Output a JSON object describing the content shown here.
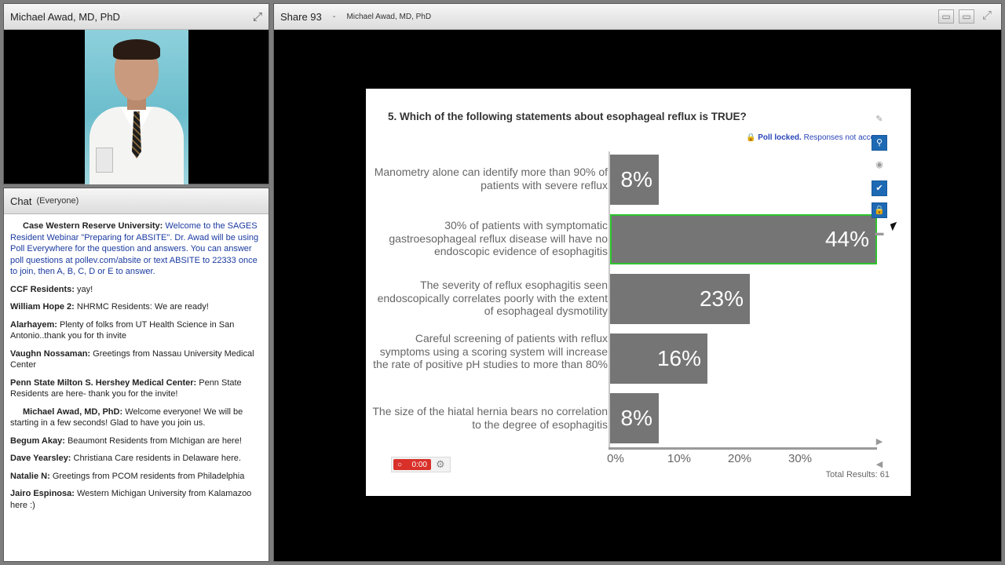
{
  "video_pod": {
    "title": "Michael Awad, MD, PhD",
    "expand_icon": "expand-icon"
  },
  "chat_pod": {
    "title": "Chat",
    "scope": "(Everyone)",
    "messages": [
      {
        "sender": "Case Western Reserve University:",
        "text": "Welcome to the SAGES Resident Webinar \"Preparing for ABSITE\".  Dr. Awad will be using Poll Everywhere for the question  and answers.   You can answer poll questions at pollev.com/absite or text ABSITE to 22333 once to join, then A, B, C, D or E to answer."
      },
      {
        "sender": "CCF Residents:",
        "text": "yay!"
      },
      {
        "sender": "William Hope 2:",
        "text": "NHRMC Residents: We are ready!"
      },
      {
        "sender": "Alarhayem:",
        "text": "Plenty of folks from UT Health Science in San Antonio..thank you for th invite"
      },
      {
        "sender": "Vaughn Nossaman:",
        "text": "Greetings from Nassau University Medical Center"
      },
      {
        "sender": "Penn State Milton S. Hershey Medical Center:",
        "text": "Penn State Residents are here- thank you for the invite!"
      },
      {
        "sender": "Michael Awad, MD, PhD:",
        "text": "Welcome everyone! We will be starting in a few seconds! Glad to have you join us."
      },
      {
        "sender": "Begum Akay:",
        "text": "Beaumont Residents from MIchigan are here!"
      },
      {
        "sender": "Dave Yearsley:",
        "text": "Christiana Care residents in Delaware here."
      },
      {
        "sender": "Natalie N:",
        "text": "Greetings from PCOM residents from Philadelphia"
      },
      {
        "sender": "Jairo Espinosa:",
        "text": "Western Michigan University from Kalamazoo here :)"
      }
    ]
  },
  "share_pod": {
    "title": "Share 93",
    "separator": "-",
    "presenter": "Michael Awad, MD, PhD"
  },
  "poll": {
    "question": "5. Which of the following statements about esophageal reflux is TRUE?",
    "lock_label": "Poll locked.",
    "lock_text": "Responses not accepted",
    "total_results": "Total Results: 61",
    "timer": "0:00",
    "accent_color": "#2ec32e",
    "bar_color": "#757575"
  },
  "chart_data": {
    "type": "bar",
    "orientation": "horizontal",
    "categories": [
      "Manometry alone can identify more than 90% of patients with severe reflux",
      "30% of patients with symptomatic gastroesophageal reflux disease will have no endoscopic evidence of esophagitis",
      "The severity of reflux esophagitis seen endoscopically correlates poorly with the extent of esophageal dysmotility",
      "Careful screening of patients with reflux symptoms using a scoring system will increase the rate of positive pH studies to more than 80%",
      "The size of the hiatal hernia bears no correlation to the degree of esophagitis"
    ],
    "values": [
      8,
      44,
      23,
      16,
      8
    ],
    "value_labels": [
      "8%",
      "44%",
      "23%",
      "16%",
      "8%"
    ],
    "correct_index": 1,
    "xticks": [
      "0%",
      "10%",
      "20%",
      "30%"
    ],
    "xlim": [
      0,
      44
    ]
  }
}
